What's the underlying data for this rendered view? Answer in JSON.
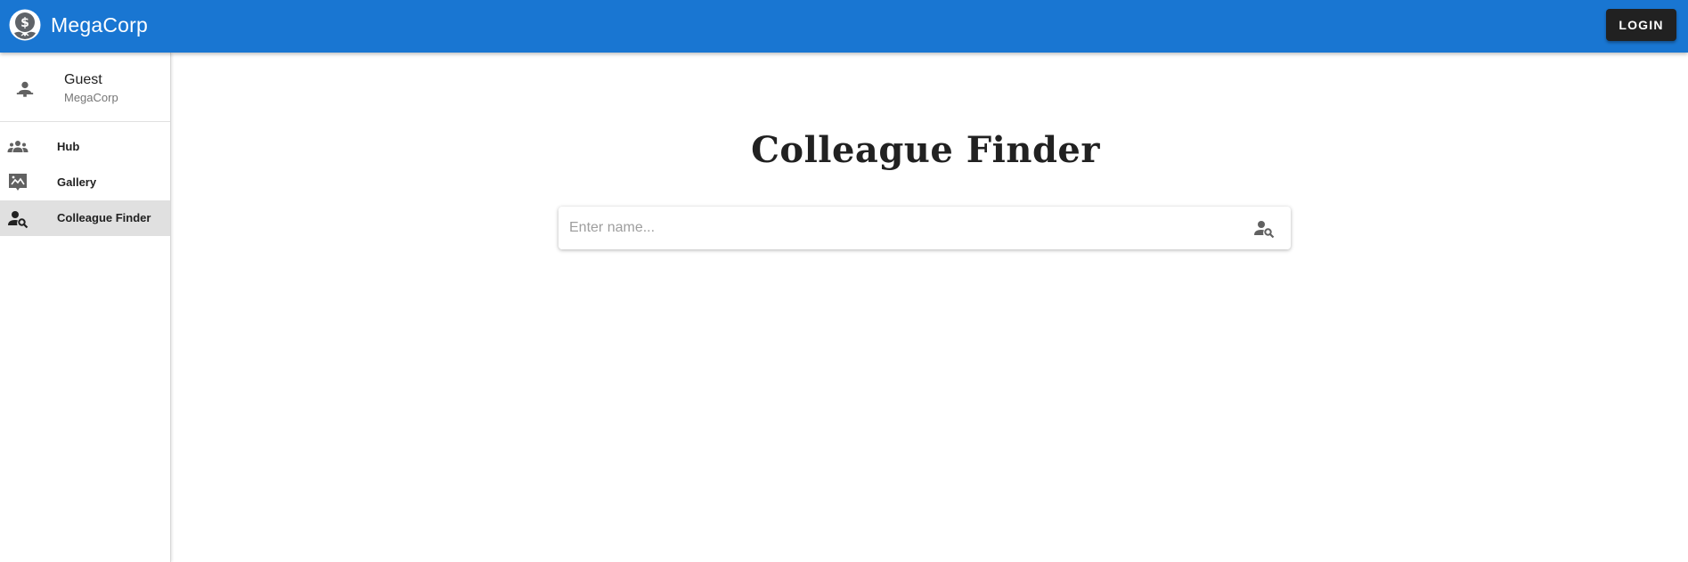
{
  "app": {
    "name": "MegaCorp",
    "logo_icon": "money-hand-icon",
    "brand_color": "#1976d2"
  },
  "header": {
    "login_label": "LOGIN"
  },
  "sidebar": {
    "profile": {
      "icon": "person-icon",
      "name": "Guest",
      "org": "MegaCorp"
    },
    "items": [
      {
        "label": "Hub",
        "icon": "group-icon",
        "active": false
      },
      {
        "label": "Gallery",
        "icon": "gallery-icon",
        "active": false
      },
      {
        "label": "Colleague Finder",
        "icon": "person-search-icon",
        "active": true
      }
    ]
  },
  "main": {
    "title": "Colleague Finder",
    "search": {
      "placeholder": "Enter name...",
      "value": "",
      "icon": "person-search-icon"
    }
  }
}
